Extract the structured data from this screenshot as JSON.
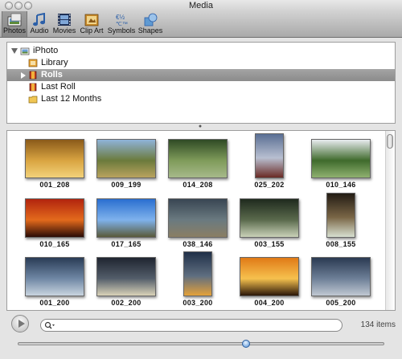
{
  "window": {
    "title": "Media"
  },
  "toolbar": {
    "items": [
      {
        "label": "Photos",
        "icon": "photos-icon",
        "selected": true
      },
      {
        "label": "Audio",
        "icon": "audio-note-icon",
        "selected": false
      },
      {
        "label": "Movies",
        "icon": "film-strip-icon",
        "selected": false
      },
      {
        "label": "Clip Art",
        "icon": "clip-art-icon",
        "selected": false
      },
      {
        "label": "Symbols",
        "icon": "symbols-icon",
        "selected": false
      },
      {
        "label": "Shapes",
        "icon": "shapes-icon",
        "selected": false
      }
    ]
  },
  "source_list": {
    "items": [
      {
        "label": "iPhoto",
        "expanded": true,
        "selected": false,
        "icon": "iphoto-icon"
      },
      {
        "label": "Library",
        "selected": false,
        "icon": "library-icon"
      },
      {
        "label": "Rolls",
        "expanded": false,
        "selected": true,
        "icon": "rolls-icon"
      },
      {
        "label": "Last Roll",
        "selected": false,
        "icon": "roll-icon"
      },
      {
        "label": "Last 12 Months",
        "selected": false,
        "icon": "folder-icon"
      }
    ]
  },
  "browser": {
    "items": [
      {
        "caption": "001_208",
        "orientation": "landscape",
        "palette": [
          "#8a5a1a",
          "#d9a441",
          "#f2d27a"
        ]
      },
      {
        "caption": "009_199",
        "orientation": "landscape",
        "palette": [
          "#8fb3d9",
          "#6b7a3c",
          "#b9a35e"
        ]
      },
      {
        "caption": "014_208",
        "orientation": "landscape",
        "palette": [
          "#2f4a25",
          "#7f9b5a",
          "#a6b98a"
        ]
      },
      {
        "caption": "025_202",
        "orientation": "portrait",
        "palette": [
          "#5a6f94",
          "#b8bfd0",
          "#6a2a24"
        ]
      },
      {
        "caption": "010_146",
        "orientation": "landscape",
        "palette": [
          "#e8ecef",
          "#3f6a2c",
          "#8fb170"
        ]
      },
      {
        "caption": "010_165",
        "orientation": "landscape",
        "palette": [
          "#b2240e",
          "#e36a1c",
          "#2a0b06"
        ]
      },
      {
        "caption": "017_165",
        "orientation": "landscape",
        "palette": [
          "#2a6fd0",
          "#7fb2ec",
          "#5a5a3a"
        ]
      },
      {
        "caption": "038_146",
        "orientation": "landscape",
        "palette": [
          "#394653",
          "#6a7a80",
          "#8a7e64"
        ]
      },
      {
        "caption": "003_155",
        "orientation": "landscape",
        "palette": [
          "#1f2a1e",
          "#5a6a4c",
          "#c9d1b8"
        ]
      },
      {
        "caption": "008_155",
        "orientation": "portrait",
        "palette": [
          "#231c14",
          "#7a6646",
          "#d7dfd0"
        ]
      },
      {
        "caption": "001_200",
        "orientation": "landscape",
        "palette": [
          "#2a3c56",
          "#6f87a4",
          "#c8d4df"
        ]
      },
      {
        "caption": "002_200",
        "orientation": "landscape",
        "palette": [
          "#1f2530",
          "#535d6a",
          "#d9d2b8"
        ]
      },
      {
        "caption": "003_200",
        "orientation": "portrait",
        "palette": [
          "#203048",
          "#5f6e80",
          "#e3a13a"
        ]
      },
      {
        "caption": "004_200",
        "orientation": "landscape",
        "palette": [
          "#e07a17",
          "#f6c14e",
          "#2a1608"
        ]
      },
      {
        "caption": "005_200",
        "orientation": "landscape",
        "palette": [
          "#2b3a52",
          "#6d7f97",
          "#c0c8d2"
        ]
      }
    ]
  },
  "bottom": {
    "search_value": "",
    "count_text": "134 items",
    "zoom_fraction": 0.62
  },
  "colors": {
    "accent": "#4f8fd6",
    "selection": "#8e8e8e"
  }
}
